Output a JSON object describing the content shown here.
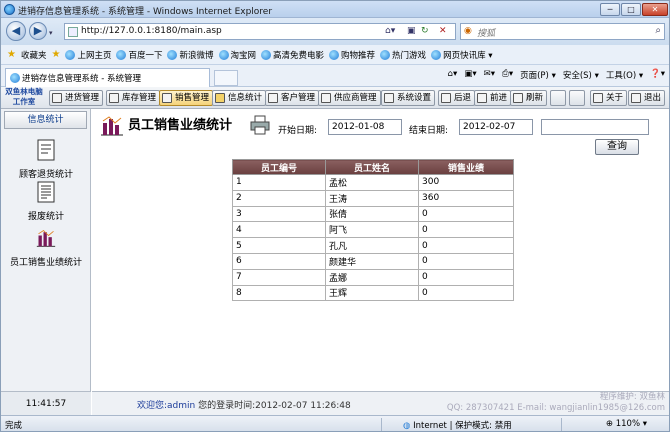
{
  "window": {
    "title": "进销存信息管理系统 - 系统管理 - Windows Internet Explorer",
    "min": "─",
    "max": "□",
    "close": "✕"
  },
  "address": {
    "url": "http://127.0.0.1:8180/main.asp",
    "search_placeholder": "搜狐"
  },
  "favorites": {
    "label": "收藏夹",
    "items": [
      "上网主页",
      "百度一下",
      "新浪微博",
      "淘宝网",
      "高清免费电影",
      "购物推荐",
      "热门游戏",
      "网页快讯库 ▾"
    ]
  },
  "tab": {
    "title": "进销存信息管理系统 - 系统管理"
  },
  "commands": {
    "page": "页面(P) ▾",
    "safety": "安全(S) ▾",
    "tools": "工具(O) ▾",
    "help": "❓▾"
  },
  "app": {
    "logo": "双鱼林电脑工作室",
    "toolbar": [
      "进货管理",
      "库存管理",
      "销售管理",
      "信息统计",
      "客户管理",
      "供应商管理",
      "系统设置",
      "后退",
      "前进",
      "刷新",
      "关于",
      "退出"
    ],
    "sidebar": {
      "header": "信息统计",
      "items": [
        "顾客退货统计",
        "报废统计",
        "员工销售业绩统计"
      ],
      "clock": "11:41:57"
    },
    "page": {
      "title": "员工销售业绩统计",
      "start_label": "开始日期:",
      "start_value": "2012-01-08",
      "end_label": "结束日期:",
      "end_value": "2012-02-07",
      "query_button": "查询",
      "columns": [
        "员工编号",
        "员工姓名",
        "销售业绩"
      ],
      "rows": [
        [
          "1",
          "孟松",
          "300"
        ],
        [
          "2",
          "王涛",
          "360"
        ],
        [
          "3",
          "张倩",
          "0"
        ],
        [
          "4",
          "阿飞",
          "0"
        ],
        [
          "5",
          "孔凡",
          "0"
        ],
        [
          "6",
          "颜建华",
          "0"
        ],
        [
          "7",
          "孟娜",
          "0"
        ],
        [
          "8",
          "王辉",
          "0"
        ]
      ]
    },
    "status": {
      "welcome_prefix": "欢迎您:",
      "user": "admin",
      "login_text": "您的登录时间:2012-02-07 11:26:48",
      "maint1": "程序维护: 双鱼林",
      "maint2": "QQ: 287307421 E-mail: wangjianlin1985@126.com"
    }
  },
  "ie_status": {
    "done": "完成",
    "zone": "Internet | 保护模式: 禁用",
    "zoom": "110%"
  }
}
